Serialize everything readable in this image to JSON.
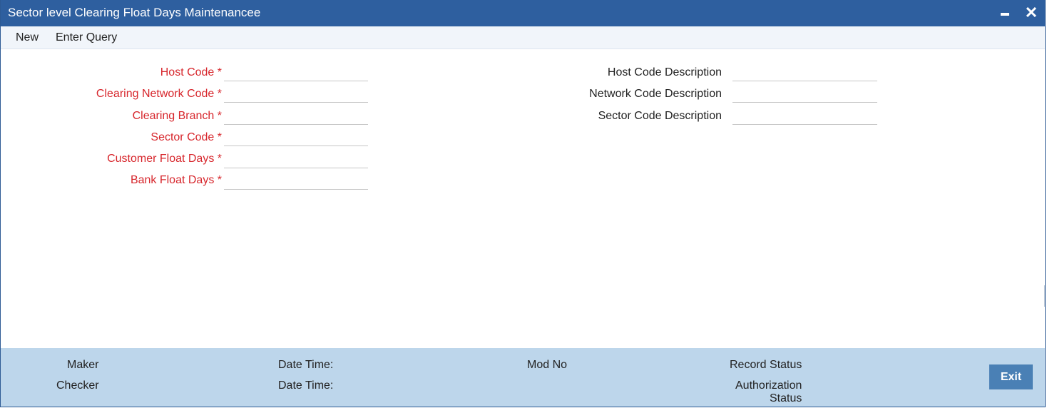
{
  "window": {
    "title": "Sector level Clearing Float Days Maintenancee",
    "minimize_icon": "minimize-icon",
    "close_icon": "close-icon",
    "close_glyph": "✕"
  },
  "menu": {
    "new_label": "New",
    "enter_query_label": "Enter Query"
  },
  "form": {
    "left_fields": [
      {
        "label": "Host Code",
        "required_mark": " *",
        "value": ""
      },
      {
        "label": "Clearing Network Code",
        "required_mark": " *",
        "value": ""
      },
      {
        "label": "Clearing Branch",
        "required_mark": " *",
        "value": ""
      },
      {
        "label": "Sector Code",
        "required_mark": " *",
        "value": ""
      },
      {
        "label": "Customer Float Days",
        "required_mark": " *",
        "value": ""
      },
      {
        "label": "Bank Float Days",
        "required_mark": " *",
        "value": ""
      }
    ],
    "right_fields": [
      {
        "label": "Host Code Description",
        "value": ""
      },
      {
        "label": "Network Code Description",
        "value": ""
      },
      {
        "label": "Sector Code Description",
        "value": ""
      }
    ]
  },
  "footer": {
    "maker_label": "Maker",
    "checker_label": "Checker",
    "date_time_label_1": "Date Time:",
    "date_time_label_2": "Date Time:",
    "mod_no_label": "Mod No",
    "record_status_label": "Record Status",
    "authorization_label_line1": "Authorization",
    "authorization_label_line2": "Status",
    "exit_label": "Exit"
  },
  "colors": {
    "titlebar": "#2e5f9f",
    "required_label": "#d7262c",
    "footer_bg": "#bdd6eb",
    "exit_button": "#4a80b5"
  }
}
